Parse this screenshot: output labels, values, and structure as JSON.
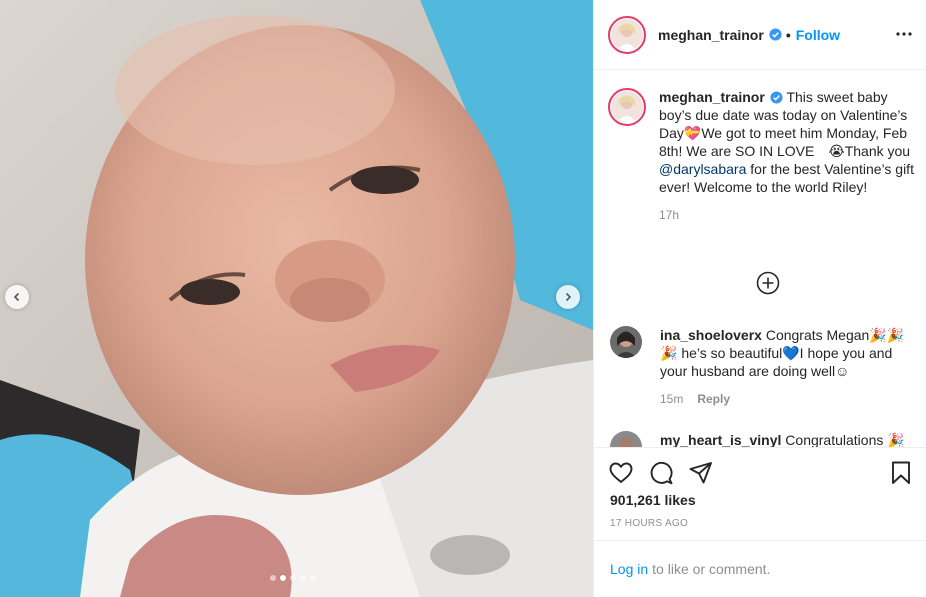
{
  "post": {
    "username": "meghan_trainor",
    "follow_label": "Follow",
    "separator": "•",
    "caption": {
      "username": "meghan_trainor",
      "text_before_mention": "This sweet baby boy’s due date was today on Valentine’s Day💝We got to meet him Monday, Feb 8th! We are SO IN LOVE 😭Thank you ",
      "mention": "@darylsabara",
      "text_after_mention": " for the best Valentine’s gift ever! Welcome to the world Riley!",
      "time": "17h"
    },
    "comments": [
      {
        "username": "ina_shoeloverx",
        "text": "Congrats Megan🎉🎉🎉 he’s so beautiful💙I hope you and your husband are doing well☺",
        "time": "15m",
        "reply_label": "Reply"
      },
      {
        "username": "my_heart_is_vinyl",
        "text": "Congratulations 🎉",
        "time": "",
        "reply_label": ""
      }
    ],
    "likes": "901,261 likes",
    "timestamp": "17 HOURS AGO",
    "login": {
      "link": "Log in",
      "rest": "to like or comment."
    },
    "carousel": {
      "slide_count": 5,
      "active_slide": 2
    },
    "icons": {
      "verified": "verified-badge-icon",
      "more": "more-options-icon",
      "like": "heart-icon",
      "comment": "comment-icon",
      "share": "paper-plane-icon",
      "save": "bookmark-icon",
      "load_more": "plus-circle-icon",
      "prev": "chevron-left-icon",
      "next": "chevron-right-icon"
    },
    "colors": {
      "accent": "#0095f6",
      "verified": "#3897f0",
      "ring": "#e23a6b",
      "muted": "#8e8e8e"
    }
  }
}
